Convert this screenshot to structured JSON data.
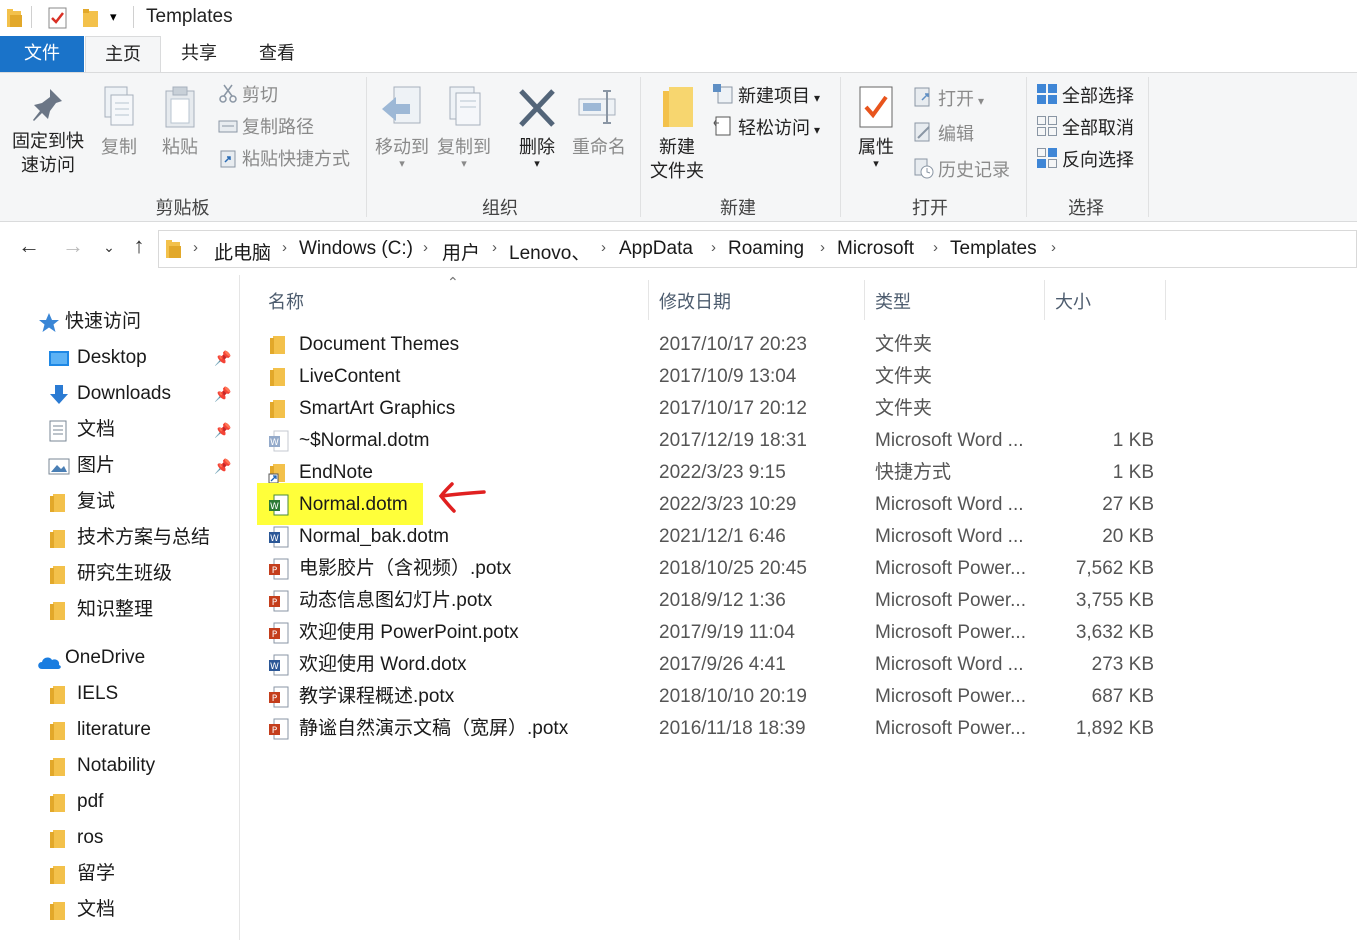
{
  "window": {
    "title": "Templates"
  },
  "tabs": {
    "file": "文件",
    "home": "主页",
    "share": "共享",
    "view": "查看"
  },
  "ribbon": {
    "clipboard": {
      "label": "剪贴板",
      "pin_quick_access": "固定到快\n速访问",
      "copy": "复制",
      "paste": "粘贴",
      "cut": "剪切",
      "copy_path": "复制路径",
      "paste_shortcut": "粘贴快捷方式"
    },
    "organize": {
      "label": "组织",
      "move_to": "移动到",
      "copy_to": "复制到",
      "delete": "删除",
      "rename": "重命名"
    },
    "new": {
      "label": "新建",
      "new_folder": "新建\n文件夹",
      "new_item": "新建项目",
      "easy_access": "轻松访问"
    },
    "open": {
      "label": "打开",
      "properties": "属性",
      "open": "打开",
      "edit": "编辑",
      "history": "历史记录"
    },
    "select": {
      "label": "选择",
      "select_all": "全部选择",
      "select_none": "全部取消",
      "invert": "反向选择"
    }
  },
  "address": {
    "crumbs": [
      "此电脑",
      "Windows (C:)",
      "用户",
      "Lenovo、",
      "AppData",
      "Roaming",
      "Microsoft",
      "Templates"
    ]
  },
  "sidebar": {
    "quick_access": "快速访问",
    "items": [
      "Desktop",
      "Downloads",
      "文档",
      "图片",
      "复试",
      "技术方案与总结",
      "研究生班级",
      "知识整理"
    ],
    "onedrive": "OneDrive",
    "onedrive_items": [
      "IELS",
      "literature",
      "Notability",
      "pdf",
      "ros",
      "留学",
      "文档"
    ]
  },
  "columns": {
    "name": "名称",
    "modified": "修改日期",
    "type": "类型",
    "size": "大小"
  },
  "files": [
    {
      "name": "Document Themes",
      "date": "2017/10/17 20:23",
      "type": "文件夹",
      "size": "",
      "kind": "folder"
    },
    {
      "name": "LiveContent",
      "date": "2017/10/9 13:04",
      "type": "文件夹",
      "size": "",
      "kind": "folder"
    },
    {
      "name": "SmartArt Graphics",
      "date": "2017/10/17 20:12",
      "type": "文件夹",
      "size": "",
      "kind": "folder"
    },
    {
      "name": "~$Normal.dotm",
      "date": "2017/12/19 18:31",
      "type": "Microsoft Word ...",
      "size": "1 KB",
      "kind": "word-faded"
    },
    {
      "name": "EndNote",
      "date": "2022/3/23 9:15",
      "type": "快捷方式",
      "size": "1 KB",
      "kind": "shortcut"
    },
    {
      "name": "Normal.dotm",
      "date": "2022/3/23 10:29",
      "type": "Microsoft Word ...",
      "size": "27 KB",
      "kind": "word-macro"
    },
    {
      "name": "Normal_bak.dotm",
      "date": "2021/12/1 6:46",
      "type": "Microsoft Word ...",
      "size": "20 KB",
      "kind": "word"
    },
    {
      "name": "电影胶片（含视频）.potx",
      "date": "2018/10/25 20:45",
      "type": "Microsoft Power...",
      "size": "7,562 KB",
      "kind": "ppt"
    },
    {
      "name": "动态信息图幻灯片.potx",
      "date": "2018/9/12 1:36",
      "type": "Microsoft Power...",
      "size": "3,755 KB",
      "kind": "ppt"
    },
    {
      "name": "欢迎使用 PowerPoint.potx",
      "date": "2017/9/19 11:04",
      "type": "Microsoft Power...",
      "size": "3,632 KB",
      "kind": "ppt"
    },
    {
      "name": "欢迎使用 Word.dotx",
      "date": "2017/9/26 4:41",
      "type": "Microsoft Word ...",
      "size": "273 KB",
      "kind": "word"
    },
    {
      "name": "教学课程概述.potx",
      "date": "2018/10/10 20:19",
      "type": "Microsoft Power...",
      "size": "687 KB",
      "kind": "ppt"
    },
    {
      "name": "静谧自然演示文稿（宽屏）.potx",
      "date": "2016/11/18 18:39",
      "type": "Microsoft Power...",
      "size": "1,892 KB",
      "kind": "ppt"
    }
  ],
  "highlight": {
    "row": "Normal.dotm",
    "color": "#ffff3a",
    "arrow_color": "#e02020"
  },
  "colors": {
    "file_tab": "#1a73c9",
    "folder": "#f3c14b",
    "word": "#2b5797",
    "ppt": "#c43e1c"
  }
}
